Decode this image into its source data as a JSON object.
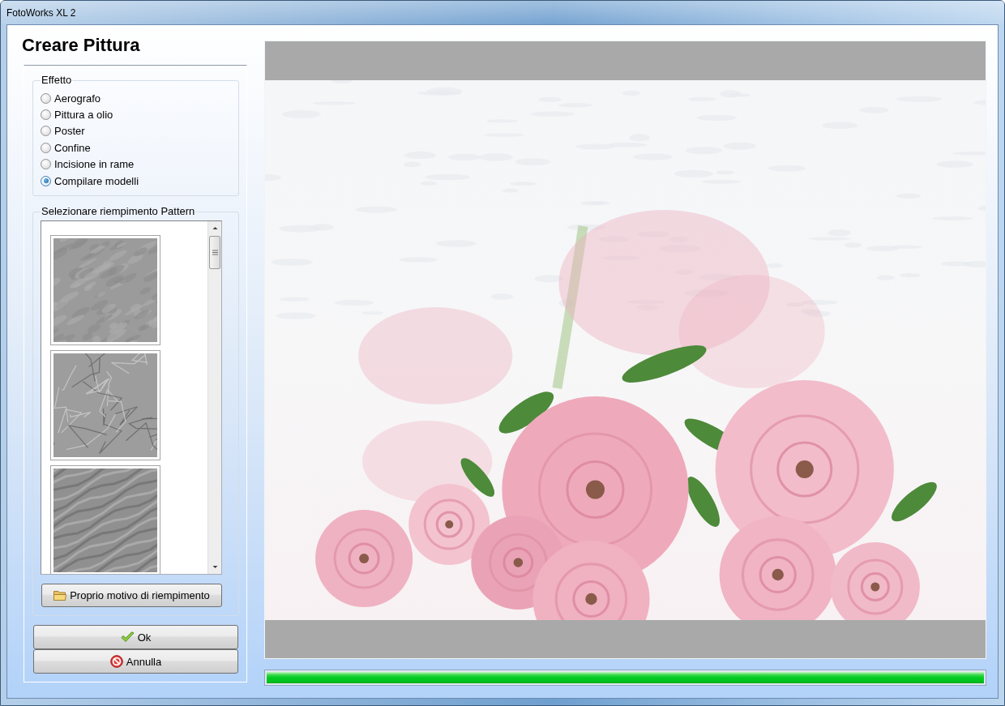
{
  "window": {
    "title": "FotoWorks XL 2"
  },
  "heading": "Creare Pittura",
  "effect_group": {
    "label": "Effetto",
    "options": [
      {
        "label": "Aerografo",
        "selected": false
      },
      {
        "label": "Pittura a olio",
        "selected": false
      },
      {
        "label": "Poster",
        "selected": false
      },
      {
        "label": "Confine",
        "selected": false
      },
      {
        "label": "Incisione in rame",
        "selected": false
      },
      {
        "label": "Compilare modelli",
        "selected": true
      }
    ]
  },
  "pattern_group": {
    "label": "Selezionare riempimento Pattern",
    "patterns": [
      {
        "kind": "stucco"
      },
      {
        "kind": "crumpled"
      },
      {
        "kind": "waves"
      }
    ],
    "button": {
      "label": "Proprio motivo di riempimento"
    }
  },
  "buttons": [
    {
      "label": "Ok",
      "kind": "ok"
    },
    {
      "label": "Annulla",
      "kind": "cancel"
    }
  ],
  "progress": {
    "level": 1
  }
}
